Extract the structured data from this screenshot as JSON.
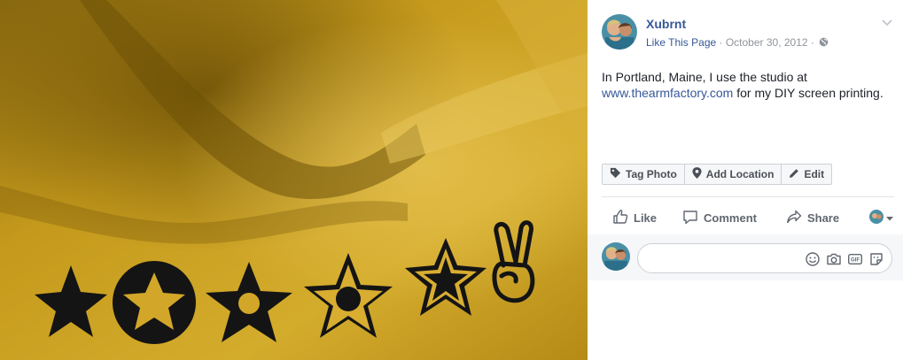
{
  "post": {
    "author": "Xubrnt",
    "like_page": "Like This Page",
    "separator": " · ",
    "date": "October 30, 2012",
    "text_before_link": "In Portland, Maine, I use the studio at ",
    "link_text": "www.thearmfactory.com",
    "text_after_link": " for my DIY screen printing."
  },
  "photo_tools": {
    "tag_photo": "Tag Photo",
    "add_location": "Add Location",
    "edit": "Edit"
  },
  "actions": {
    "like": "Like",
    "comment": "Comment",
    "share": "Share"
  },
  "comment": {
    "placeholder": ""
  },
  "icons": {
    "globe": "globe-icon",
    "caret": "chevron-down-icon",
    "tag": "tag-icon",
    "location": "map-pin-icon",
    "pencil": "pencil-icon",
    "thumbs_up": "thumbs-up-icon",
    "speech_bubble": "speech-bubble-icon",
    "share_arrow": "share-arrow-icon",
    "emoji": "emoji-icon",
    "camera": "camera-icon",
    "gif": "gif-icon",
    "sticker": "sticker-icon"
  },
  "colors": {
    "link_blue": "#365899",
    "shirt_yellow": "#c89a1a",
    "print_black": "#141414",
    "muted_text": "#90949c"
  }
}
